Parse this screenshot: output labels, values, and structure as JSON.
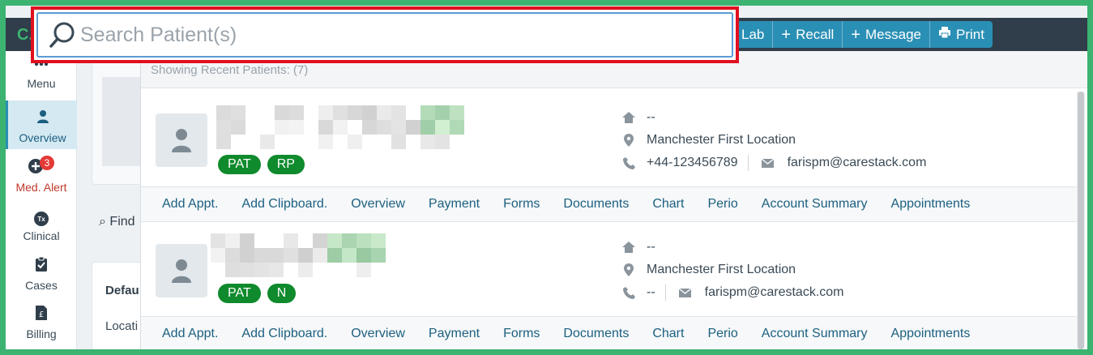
{
  "search": {
    "placeholder": "Search Patient(s)",
    "value": ""
  },
  "topbar": {
    "logo_fragment": "C.",
    "actions": [
      {
        "label": "Lab",
        "icon": ""
      },
      {
        "label": "Recall",
        "icon": "plus-icon"
      },
      {
        "label": "Message",
        "icon": "plus-icon"
      },
      {
        "label": "Print",
        "icon": "print-icon"
      }
    ]
  },
  "sidebar": {
    "items": [
      {
        "label": "Menu",
        "icon": "grid-icon"
      },
      {
        "label": "Overview",
        "icon": "person-icon"
      },
      {
        "label": "Med. Alert",
        "icon": "plus-circle-icon",
        "badge": "3"
      },
      {
        "label": "Clinical",
        "icon": "tx-icon",
        "icon_text": "Tx"
      },
      {
        "label": "Cases",
        "icon": "clipboard-icon"
      },
      {
        "label": "Billing",
        "icon": "billing-icon"
      }
    ]
  },
  "background": {
    "find_label": "Find",
    "panel_title": "Defau",
    "panel_field": "Locati"
  },
  "dropdown": {
    "header": "Showing Recent Patients:  (7)",
    "patients": [
      {
        "tags": [
          "PAT",
          "RP"
        ],
        "address": "--",
        "location": "Manchester First Location",
        "phone": "+44-123456789",
        "email": "farispm@carestack.com"
      },
      {
        "tags": [
          "PAT",
          "N"
        ],
        "address": "--",
        "location": "Manchester First Location",
        "phone": "--",
        "email": "farispm@carestack.com"
      }
    ],
    "links": [
      "Add Appt.",
      "Add Clipboard.",
      "Overview",
      "Payment",
      "Forms",
      "Documents",
      "Chart",
      "Perio",
      "Account Summary",
      "Appointments"
    ]
  },
  "colors": {
    "accent": "#2a8fb5",
    "tag_green": "#0f8a2c",
    "highlight_red": "#e01020",
    "frame_green": "#3cb371",
    "topbar": "#2f3e4a"
  }
}
